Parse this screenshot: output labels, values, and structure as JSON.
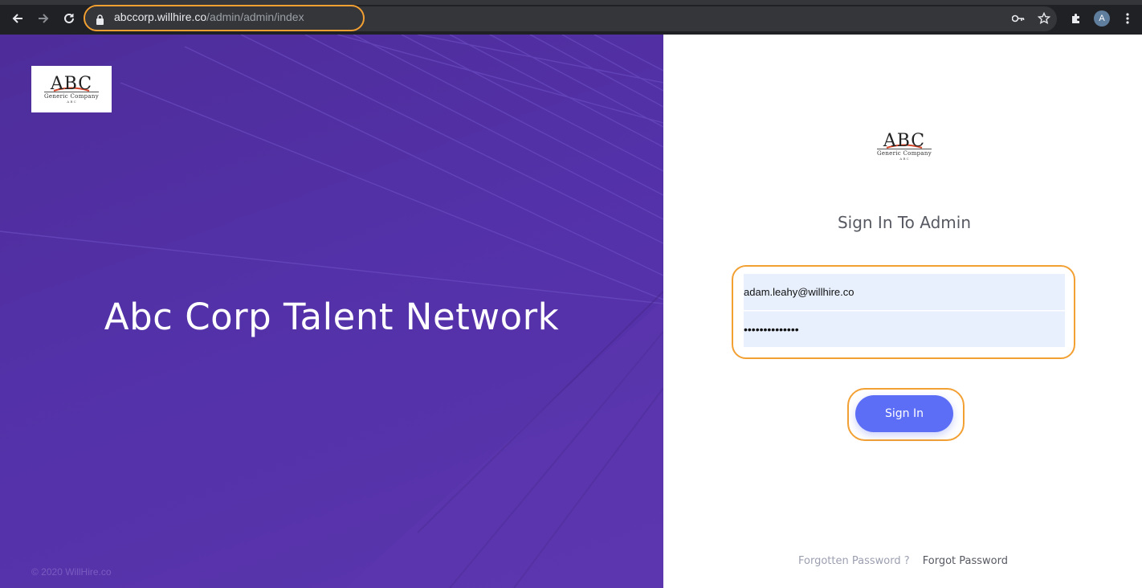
{
  "browser": {
    "url_host": "abccorp.willhire.co",
    "url_path": "/admin/admin/index",
    "avatar_initial": "A",
    "icons": [
      "back-icon",
      "forward-icon",
      "reload-icon",
      "lock-icon",
      "key-icon",
      "star-icon",
      "extensions-icon",
      "menu-icon"
    ]
  },
  "hero": {
    "logo": {
      "abc": "ABC",
      "company": "Generic Company",
      "sub": "A B C"
    },
    "title": "Abc Corp Talent Network",
    "footer": "© 2020 WillHire.co"
  },
  "login": {
    "logo": {
      "abc": "ABC",
      "company": "Generic Company",
      "sub": "A B C"
    },
    "title": "Sign In To Admin",
    "email_value": "adam.leahy@willhire.co",
    "password_masked": "••••••••••••••",
    "signin_label": "Sign In",
    "forgotten_text": "Forgotten Password ?",
    "forgot_link": "Forgot Password"
  },
  "colors": {
    "hero_purple": "#5331a8",
    "button_blue": "#5b6ef5",
    "highlight_orange": "#f3a033",
    "field_bg": "#e8f0fe"
  }
}
